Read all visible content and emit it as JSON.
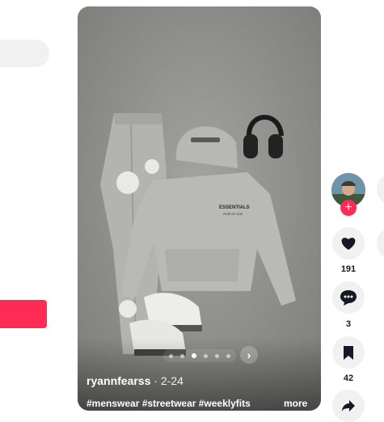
{
  "post": {
    "author": "ryannfearss",
    "date": "2-24",
    "caption": "#menswear #streetwear #weeklyfits",
    "more_label": "more",
    "image": {
      "hoodie_brand": "ESSENTIALS",
      "hoodie_sub": "FEAR OF GOD"
    },
    "carousel": {
      "total": 6,
      "current": 2
    }
  },
  "actions": {
    "likes": "191",
    "comments": "3",
    "saves": "42"
  },
  "icons": [
    "plus-icon",
    "heart-icon",
    "comment-icon",
    "bookmark-icon",
    "share-icon",
    "chevron-right-icon"
  ],
  "colors": {
    "accent": "#fe2c55",
    "rail_bg": "#f1f1f2",
    "text": "#161823"
  }
}
